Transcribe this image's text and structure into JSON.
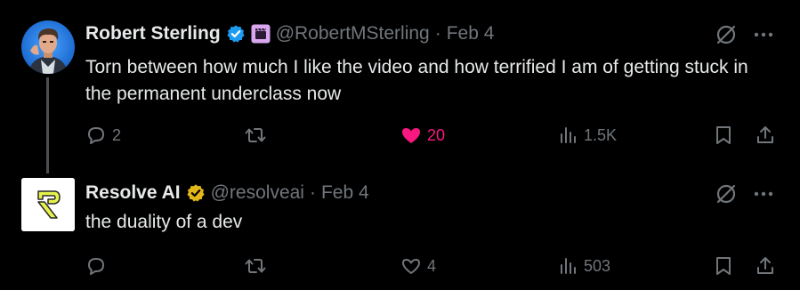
{
  "tweets": [
    {
      "author_name": "Robert Sterling",
      "handle": "@RobertMSterling",
      "separator": "·",
      "date": "Feb 4",
      "text": "Torn between how much I like the video and how terrified I am of getting stuck in the permanent underclass now",
      "verified_badge_color": "#1d9bf0",
      "affiliate_badge_icon": "clapperboard-badge-icon",
      "actions": {
        "replies": "2",
        "reposts": "",
        "likes": "20",
        "liked": true,
        "views": "1.5K"
      }
    },
    {
      "author_name": "Resolve AI",
      "handle": "@resolveai",
      "separator": "·",
      "date": "Feb 4",
      "text": "the duality of a dev",
      "verified_badge_color": "#e2b719",
      "actions": {
        "replies": "",
        "reposts": "",
        "likes": "4",
        "liked": false,
        "views": "503"
      }
    }
  ],
  "colors": {
    "background": "#000000",
    "text_primary": "#e7e9ea",
    "text_secondary": "#71767b",
    "like_active": "#f91880",
    "thread_line": "#4a4e52",
    "resolve_logo": "#e6f34a"
  }
}
